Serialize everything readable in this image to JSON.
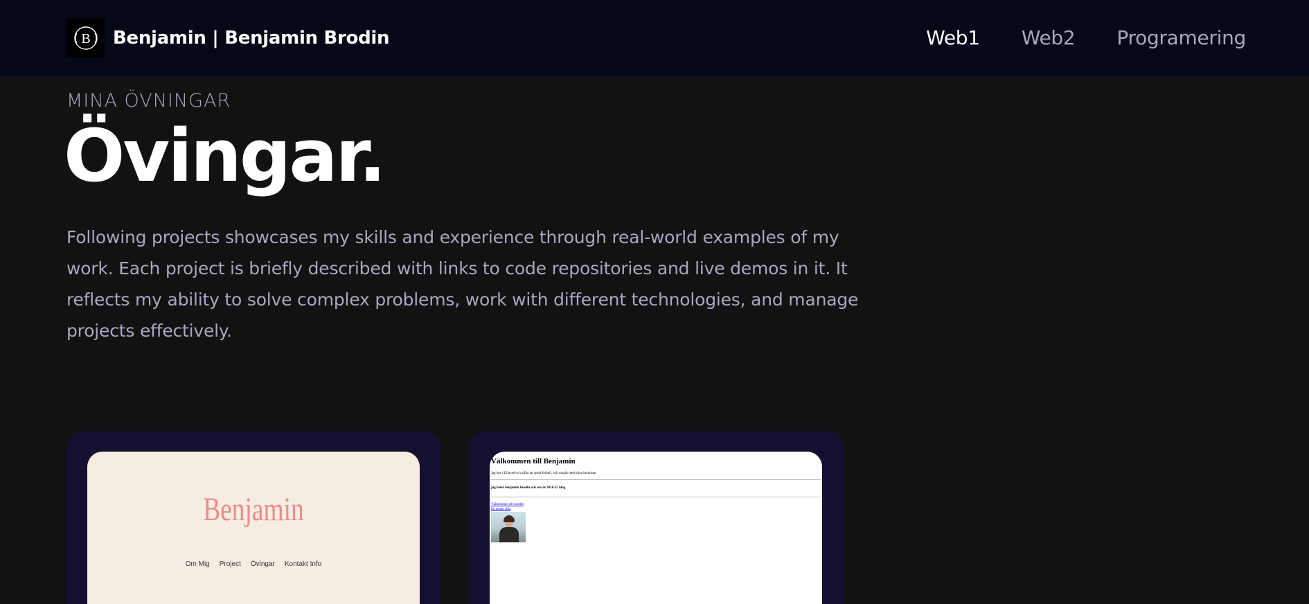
{
  "nav": {
    "brand": "Benjamin | Benjamin Brodin",
    "logo_letter": "B",
    "links": [
      "Web1",
      "Web2",
      "Programering"
    ],
    "active_index": 0
  },
  "hero": {
    "subtitle": "MINA ÖVNINGAR",
    "title": "Övingar.",
    "description": "Following projects showcases my skills and experience through real-world examples of my work. Each project is briefly described with links to code repositories and live demos in it. It reflects my ability to solve complex problems, work with different technologies, and manage projects effectively."
  },
  "projects": [
    {
      "preview_title": "Benjamin",
      "menu": [
        "Om Mig",
        "Project",
        "Övingar",
        "Kontakt Info"
      ]
    },
    {
      "preview_title": "Välkommen till Benjamin",
      "text": "Jag bor i Ullaved och gillar att spela fotboll, och umgås med mina kompisar",
      "text2": "jag heter benjamin brodin och sen är 2018-25 idag",
      "links": [
        "Välkommen till mordet",
        "En annan sida"
      ]
    }
  ],
  "colors": {
    "nav_bg": "#050816",
    "page_bg": "#121212",
    "card_bg": "#151030",
    "secondary_text": "#aaa6c3",
    "preview1_title": "#ef8a8a"
  }
}
